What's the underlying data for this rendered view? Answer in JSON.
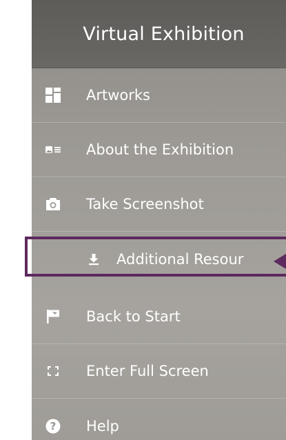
{
  "header": {
    "title": "Virtual Exhibition"
  },
  "menu": {
    "items": [
      {
        "label": "Artworks",
        "icon": "grid-icon"
      },
      {
        "label": "About the Exhibition",
        "icon": "info-card-icon"
      },
      {
        "label": "Take Screenshot",
        "icon": "camera-icon"
      },
      {
        "label": "Additional Resour",
        "icon": "download-icon"
      },
      {
        "label": "Back to Start",
        "icon": "flag-icon"
      },
      {
        "label": "Enter Full Screen",
        "icon": "fullscreen-icon"
      },
      {
        "label": "Help",
        "icon": "help-icon"
      }
    ]
  },
  "colors": {
    "panel_header": "#5e5c59",
    "panel_body": "#a6a39e",
    "highlight": "#5c2a5e",
    "text": "#ffffff"
  }
}
